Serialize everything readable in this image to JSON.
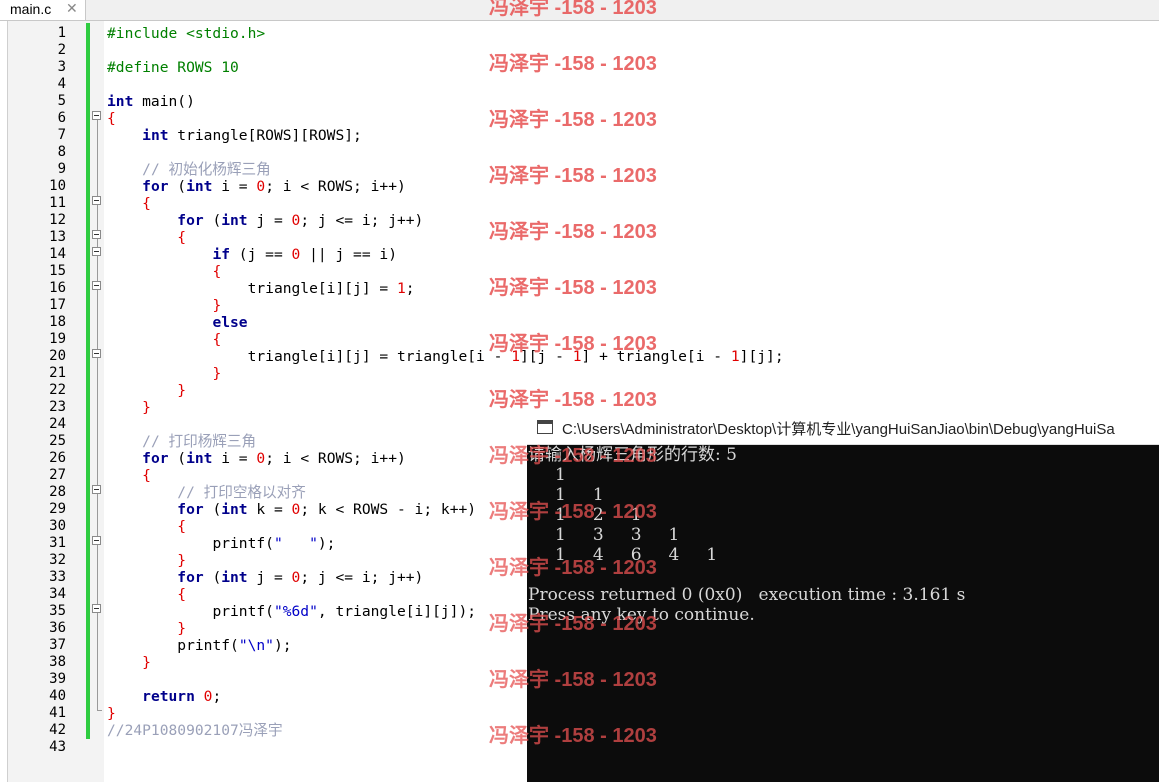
{
  "tab": {
    "label": "main.c",
    "close_glyph": "✕"
  },
  "line_numbers": [
    "1",
    "2",
    "3",
    "4",
    "5",
    "6",
    "7",
    "8",
    "9",
    "10",
    "11",
    "12",
    "13",
    "14",
    "15",
    "16",
    "17",
    "18",
    "19",
    "20",
    "21",
    "22",
    "23",
    "24",
    "25",
    "26",
    "27",
    "28",
    "29",
    "30",
    "31",
    "32",
    "33",
    "34",
    "35",
    "36",
    "37",
    "38",
    "39",
    "40",
    "41",
    "42",
    "43"
  ],
  "code": {
    "l1": "#include <stdio.h>",
    "l3": "#define ROWS 10",
    "l5_kw": "int",
    "l5_rest": " main()",
    "l6": "{",
    "l7_kw": "int",
    "l7_rest": " triangle[ROWS][ROWS];",
    "l9": "// 初始化杨辉三角",
    "l10_kw1": "for",
    "l10_a": " (",
    "l10_kw2": "int",
    "l10_b": " i = ",
    "l10_n": "0",
    "l10_c": "; i < ROWS; i++)",
    "l11": "{",
    "l12_kw1": "for",
    "l12_a": " (",
    "l12_kw2": "int",
    "l12_b": " j = ",
    "l12_n": "0",
    "l12_c": "; j <= i; j++)",
    "l13": "{",
    "l14_kw": "if",
    "l14_a": " (j == ",
    "l14_n": "0",
    "l14_b": " || j == i)",
    "l15": "{",
    "l16_a": "triangle[i][j] = ",
    "l16_n": "1",
    "l16_b": ";",
    "l17": "}",
    "l18_kw": "else",
    "l19": "{",
    "l20_a": "triangle[i][j] = triangle[i - ",
    "l20_n1": "1",
    "l20_b": "][j - ",
    "l20_n2": "1",
    "l20_c": "] + triangle[i - ",
    "l20_n3": "1",
    "l20_d": "][j];",
    "l21": "}",
    "l22": "}",
    "l23": "}",
    "l25": "// 打印杨辉三角",
    "l26_kw1": "for",
    "l26_a": " (",
    "l26_kw2": "int",
    "l26_b": " i = ",
    "l26_n": "0",
    "l26_c": "; i < ROWS; i++)",
    "l27": "{",
    "l28": "// 打印空格以对齐",
    "l29_kw1": "for",
    "l29_a": " (",
    "l29_kw2": "int",
    "l29_b": " k = ",
    "l29_n": "0",
    "l29_c": "; k < ROWS - i; k++)",
    "l30": "{",
    "l31_a": "printf(",
    "l31_s": "\"   \"",
    "l31_b": ");",
    "l32": "}",
    "l33_kw1": "for",
    "l33_a": " (",
    "l33_kw2": "int",
    "l33_b": " j = ",
    "l33_n": "0",
    "l33_c": "; j <= i; j++)",
    "l34": "{",
    "l35_a": "printf(",
    "l35_s": "\"%6d\"",
    "l35_b": ", triangle[i][j]);",
    "l36": "}",
    "l37_a": "printf(",
    "l37_s": "\"\\n\"",
    "l37_b": ");",
    "l38": "}",
    "l40_kw": "return",
    "l40_a": " ",
    "l40_n": "0",
    "l40_b": ";",
    "l41": "}",
    "l42": "//24P1080902107冯泽宇"
  },
  "watermark": "冯泽宇 -158 - 1203",
  "console": {
    "title": "C:\\Users\\Administrator\\Desktop\\计算机专业\\yangHuiSanJiao\\bin\\Debug\\yangHuiSa",
    "lines": [
      "请输入杨辉三角形的行数: 5",
      "     1",
      "     1     1",
      "     1     2     1",
      "     1     3     3     1",
      "     1     4     6     4     1",
      "",
      "Process returned 0 (0x0)   execution time : 3.161 s",
      "Press any key to continue."
    ]
  },
  "colors": {
    "keyword": "#00008b",
    "preprocessor": "#008000",
    "number": "#e00000",
    "string": "#0000c8",
    "comment": "#9aa0b8",
    "change_bar": "#2ecc40",
    "watermark": "#e65050",
    "console_bg": "#0c0c0c"
  }
}
